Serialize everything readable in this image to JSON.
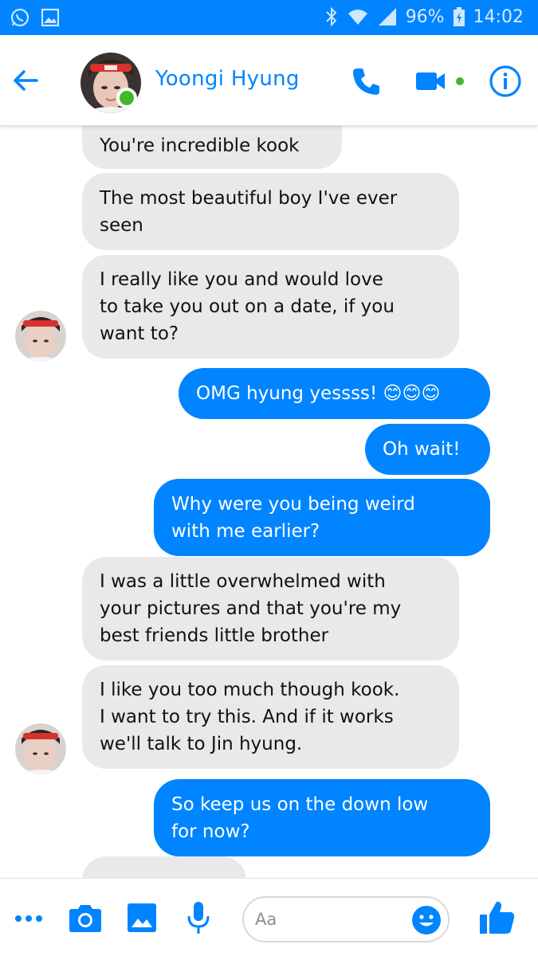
{
  "status_bar": {
    "battery": "96%",
    "time": "14:02",
    "left_icons": [
      "whatsapp-icon",
      "image-icon"
    ],
    "right_icons": [
      "bluetooth-icon",
      "wifi-icon",
      "signal-icon",
      "battery-icon"
    ]
  },
  "header": {
    "contact_name": "Yoongi Hyung",
    "online": true,
    "accent": "#0084ff",
    "online_color": "#42b72a"
  },
  "messages": [
    {
      "side": "in",
      "text": "You're incredible kook"
    },
    {
      "side": "in",
      "text": "The most beautiful boy I've ever\nseen"
    },
    {
      "side": "in",
      "text": "I really like you and would love\nto take you out on a date, if you\nwant to?",
      "avatar": true
    },
    {
      "side": "out",
      "text": "OMG hyung yessss! 😊😊😊"
    },
    {
      "side": "out",
      "text": "Oh wait!"
    },
    {
      "side": "out",
      "text": "Why were you being weird\nwith me earlier?"
    },
    {
      "side": "in",
      "text": "I was a little overwhelmed with\nyour pictures and that you're my\nbest friends little brother"
    },
    {
      "side": "in",
      "text": "I like you too much though kook.\nI want to try this. And if it works\nwe'll talk to Jin hyung.",
      "avatar": true
    },
    {
      "side": "out",
      "text": "So keep us on the down low\nfor now?"
    },
    {
      "side": "in",
      "text": ""
    }
  ],
  "composer": {
    "placeholder": "Aa",
    "icons": [
      "more-icon",
      "camera-icon",
      "gallery-icon",
      "mic-icon",
      "emoji-icon",
      "like-icon"
    ]
  },
  "colors": {
    "incoming_bubble": "#e9e9e9",
    "outgoing_bubble": "#0084ff"
  }
}
